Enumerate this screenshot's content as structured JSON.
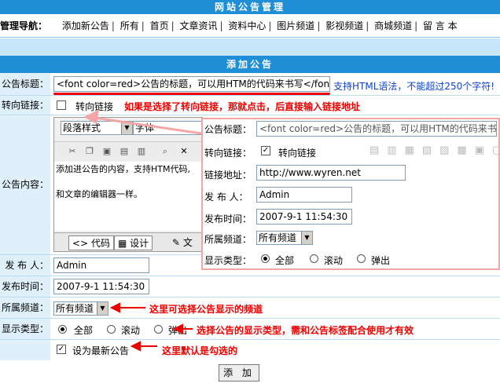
{
  "header": {
    "title": "网站公告管理"
  },
  "nav": {
    "label": "管理导航：",
    "items": [
      "添加新公告",
      "所有",
      "首页",
      "文章资讯",
      "资料中心",
      "图片频道",
      "影视频道",
      "商城频道",
      "留 言 本"
    ]
  },
  "form": {
    "title": "添加公告",
    "title_label": "公告标题：",
    "title_value": "<font color=red>公告的标题，可以用HTM的代码来书写</font>",
    "title_hint": "支持HTML语法，不能超过250个字符!",
    "redirect_label": "转向链接：",
    "redirect_checkbox": "转向链接",
    "redirect_note": "如果是选择了转向链接，那就点击，后直接输入链接地址",
    "content_label": "公告内容：",
    "editor_style": "段落样式",
    "editor_font": "字体",
    "editor_text1": "添加进公告的内容，支持HTM代码,",
    "editor_text2": "和文章的编辑器一样。",
    "mode_code": "代码",
    "mode_design": "设计",
    "mode_text": "文",
    "publisher_label": "发 布 人：",
    "publisher_value": "Admin",
    "time_label": "发布时间：",
    "time_value": "2007-9-1 11:54:30",
    "channel_label": "所属频道：",
    "channel_value": "所有频道",
    "channel_note": "这里可选择公告显示的频道",
    "type_label": "显示类型：",
    "type_options": [
      "全部",
      "滚动",
      "弹出"
    ],
    "type_note": "选择公告的显示类型，需和公告标签配合使用才有效",
    "latest_checkbox": "设为最新公告",
    "latest_note": "这里默认是勾选的",
    "submit": "添 加"
  },
  "overlay": {
    "title_label": "公告标题：",
    "title_value": "<font color=red>公告的标题，可以用HTM的代码来书写",
    "redirect_label": "转向链接：",
    "redirect_checkbox": "转向链接",
    "url_label": "链接地址：",
    "url_value": "http://www.wyren.net",
    "publisher_label": "发 布 人：",
    "publisher_value": "Admin",
    "time_label": "发布时间：",
    "time_value": "2007-9-1 11:54:30",
    "channel_label": "所属频道：",
    "channel_value": "所有频道",
    "type_label": "显示类型：",
    "type_options": [
      "全部",
      "滚动",
      "弹出"
    ]
  },
  "colors": {
    "header_bg": "#1e8fd6",
    "label_bg": "#dff0fb",
    "annotation": "#e00000",
    "hint": "#1044cc"
  }
}
